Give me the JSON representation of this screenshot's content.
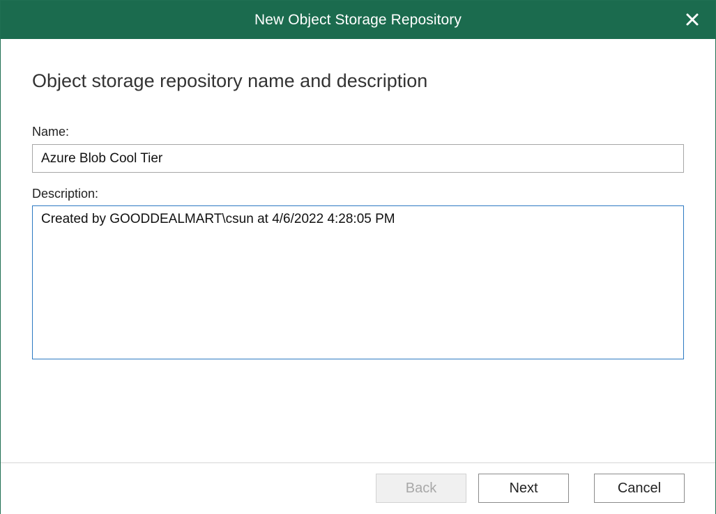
{
  "window": {
    "title": "New Object Storage Repository",
    "title_bar_color": "#1b6b4e"
  },
  "page": {
    "heading": "Object storage repository name and description"
  },
  "form": {
    "name_label": "Name:",
    "name_value": "Azure Blob Cool Tier",
    "description_label": "Description:",
    "description_value": "Created by GOODDEALMART\\csun at 4/6/2022 4:28:05 PM"
  },
  "buttons": {
    "back_label": "Back",
    "back_enabled": false,
    "next_label": "Next",
    "cancel_label": "Cancel"
  },
  "icons": {
    "close": "close-icon"
  }
}
